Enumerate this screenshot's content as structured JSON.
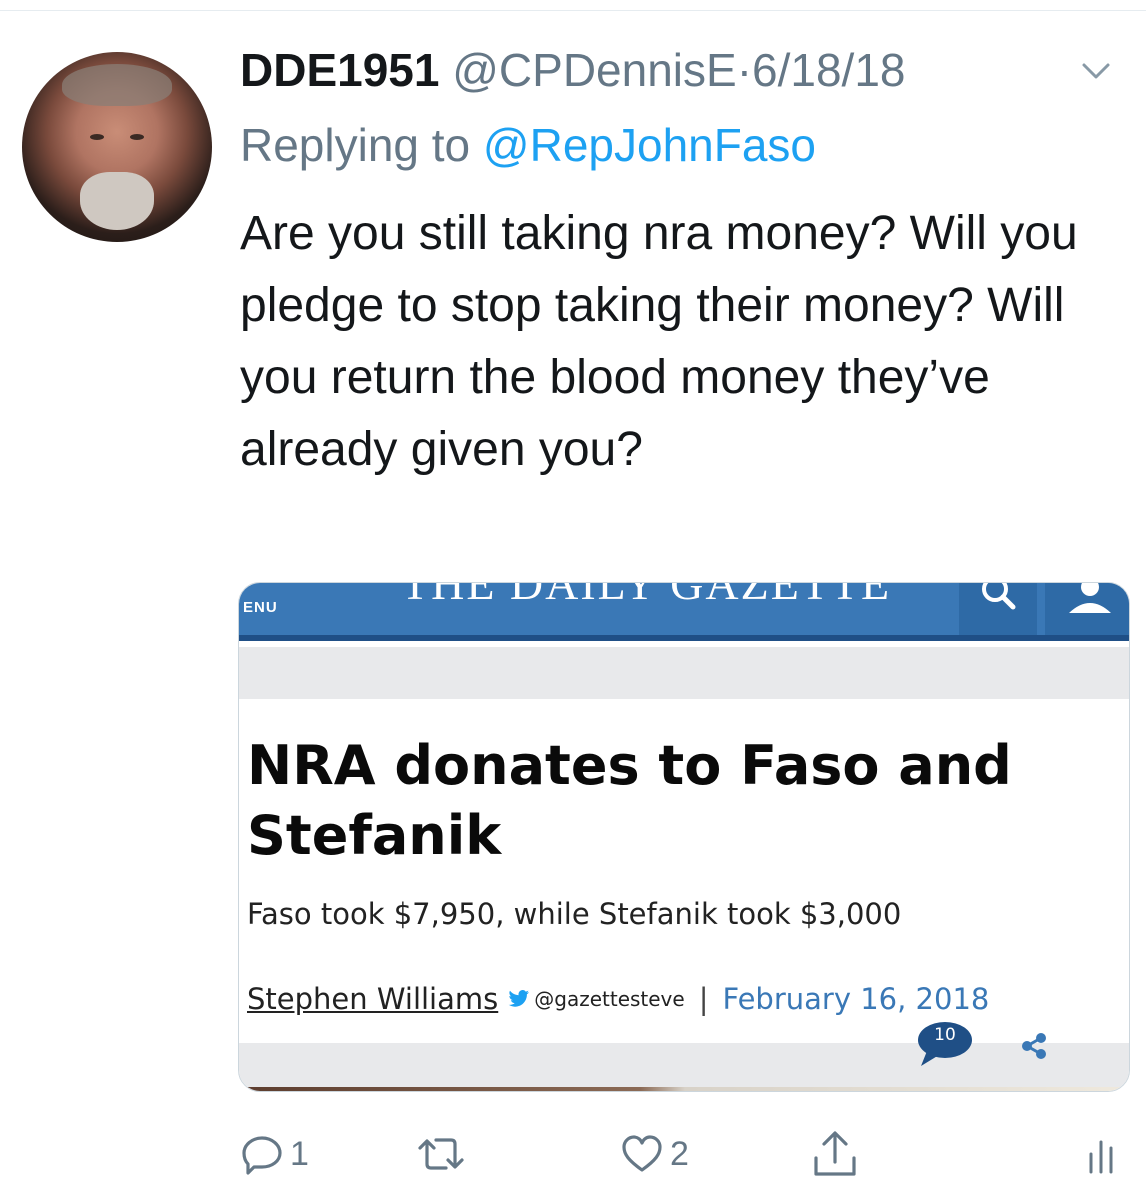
{
  "tweet": {
    "author_name": "DDE1951",
    "author_handle": "@CPDennisE",
    "separator": "·",
    "date": "6/18/18",
    "replying_prefix": "Replying to ",
    "replying_to": "@RepJohnFaso",
    "text": "Are you still taking nra money? Will you pledge to stop taking their money? Will you return the blood money they’ve already given you?"
  },
  "card": {
    "menu_label": "ENU",
    "masthead": "THE DAILY GAZETTE",
    "headline": "NRA donates to Faso and Stefanik",
    "subheadline": "Faso took $7,950, while Stefanik took $3,000",
    "author": "Stephen Williams",
    "author_twitter": "@gazettesteve",
    "separator": "|",
    "published": "February 16, 2018",
    "comment_count": "10"
  },
  "actions": {
    "reply_count": "1",
    "retweet_count": "",
    "like_count": "2"
  },
  "icons": [
    "chevron-down-icon",
    "search-icon",
    "user-icon",
    "twitter-bird-icon",
    "comment-icon",
    "share-icon",
    "reply-icon",
    "retweet-icon",
    "like-icon",
    "upload-icon",
    "analytics-icon"
  ],
  "colors": {
    "link_blue": "#1da1f2",
    "secondary_text": "#657786",
    "gazette_blue": "#3a78b6"
  }
}
